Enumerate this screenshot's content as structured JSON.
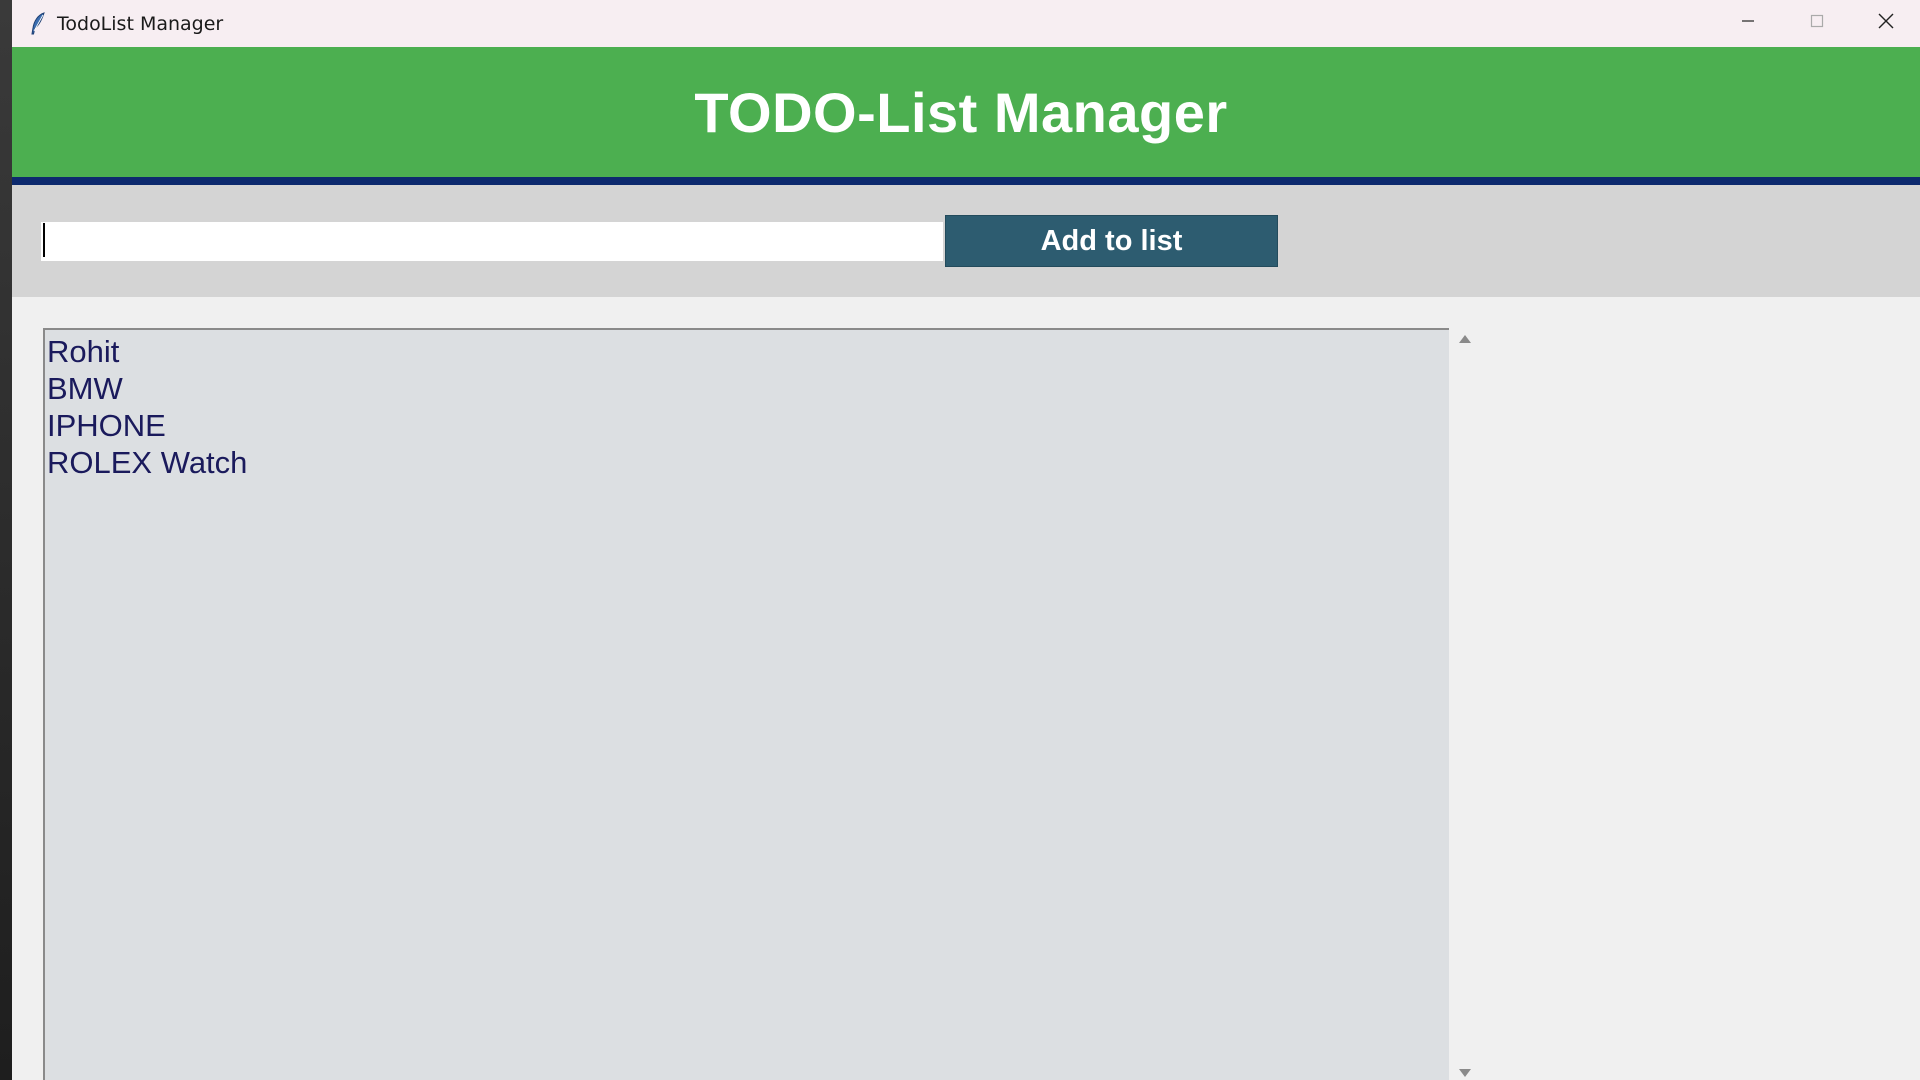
{
  "window": {
    "title": "TodoList Manager",
    "controls": [
      "minimize",
      "maximize",
      "close"
    ]
  },
  "header": {
    "title": "TODO-List Manager"
  },
  "input": {
    "value": "",
    "placeholder": ""
  },
  "add_button": {
    "label": "Add to list"
  },
  "list": {
    "items": [
      "Rohit",
      "BMW",
      "IPHONE",
      "ROLEX Watch"
    ]
  },
  "colors": {
    "header_bg": "#4caf50",
    "header_rule": "#0d2a6e",
    "button_bg": "#2d5c70",
    "list_bg": "#dcdfe2",
    "list_text": "#1a1a5c"
  },
  "icons": {
    "app": "feather-icon",
    "minimize": "minimize-icon",
    "maximize": "maximize-icon",
    "close": "close-icon",
    "scroll_up": "scroll-up-arrow-icon",
    "scroll_down": "scroll-down-arrow-icon"
  }
}
